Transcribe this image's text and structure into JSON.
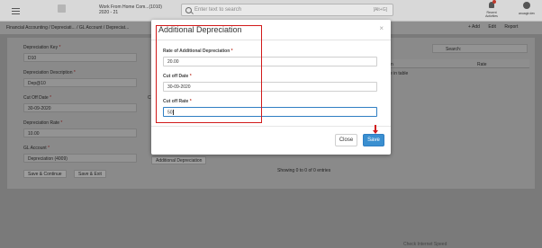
{
  "topbar": {
    "company": "Work From Home Com...(1010)",
    "year": "2020 - 21",
    "search_placeholder": "Enter text to search",
    "search_shortcut": "[Alt+G]",
    "recent_label": "Recent Activities",
    "user_label": "anuagir.dev"
  },
  "breadcrumb": {
    "text": "Financial Accounting / Depreciati... / GL Account / Depreciat..."
  },
  "actions": {
    "add": "+ Add",
    "edit": "Edit",
    "report": "Report"
  },
  "form": {
    "depr_key_label": "Depreciation Key",
    "depr_key_value": "D10",
    "depr_desc_label": "Depreciation Description",
    "depr_desc_value": "Dep@10",
    "cutoff_date_label": "Cut Off Date",
    "cutoff_date_value": "30-09-2020",
    "depr_rate_label": "Depreciation Rate",
    "depr_rate_value": "10.00",
    "gl_account_label": "GL Account",
    "gl_account_value": "Depreciation (4009)",
    "save_continue": "Save & Continue",
    "save_exit": "Save & Exit",
    "additional_depr_btn": "Additional Depreciation",
    "entries_text": "Showing 0 to 0 of 0 entries",
    "cutoff_short": "C",
    "required_mark": "*"
  },
  "right_table": {
    "search_label": "Search:",
    "col_date": "ation",
    "col_rate": "Rate",
    "empty_text": "available in table"
  },
  "footer": {
    "note": "Check Internet Speed"
  },
  "modal": {
    "title": "Additional Depreciation",
    "close_icon": "×",
    "rate_label": "Rate of Additional Depreciation",
    "rate_value": "20.00",
    "cutoff_date_label": "Cut off Date",
    "cutoff_date_value": "30-09-2020",
    "cutoff_rate_label": "Cut off Rate",
    "cutoff_rate_value": "50",
    "close_button": "Close",
    "save_button": "Save"
  },
  "colors": {
    "primary": "#3a8fd0",
    "annotation": "#d11a1a",
    "required": "#c0392b"
  }
}
